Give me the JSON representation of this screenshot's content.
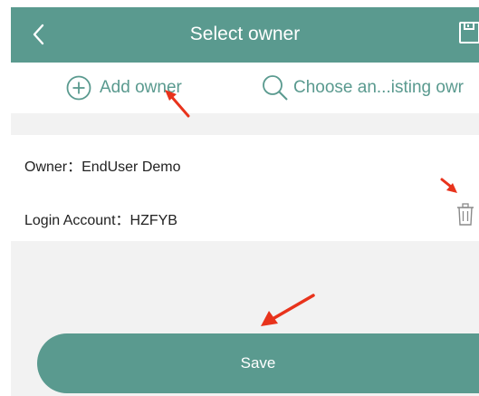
{
  "header": {
    "title": "Select owner",
    "back_icon": "chevron-left-icon",
    "save_icon": "save-icon"
  },
  "actions": {
    "add_label": "Add owner",
    "add_icon": "plus-circle-icon",
    "choose_label": "Choose an...isting owr",
    "choose_icon": "search-icon"
  },
  "owner_card": {
    "owner_line": "Owner：EndUser Demo",
    "login_line": "Login Account：HZFYB",
    "delete_icon": "trash-icon"
  },
  "footer": {
    "save_label": "Save"
  },
  "colors": {
    "primary": "#5a9a8f",
    "background": "#f2f2f2",
    "annotation_arrow": "#e8331c"
  }
}
